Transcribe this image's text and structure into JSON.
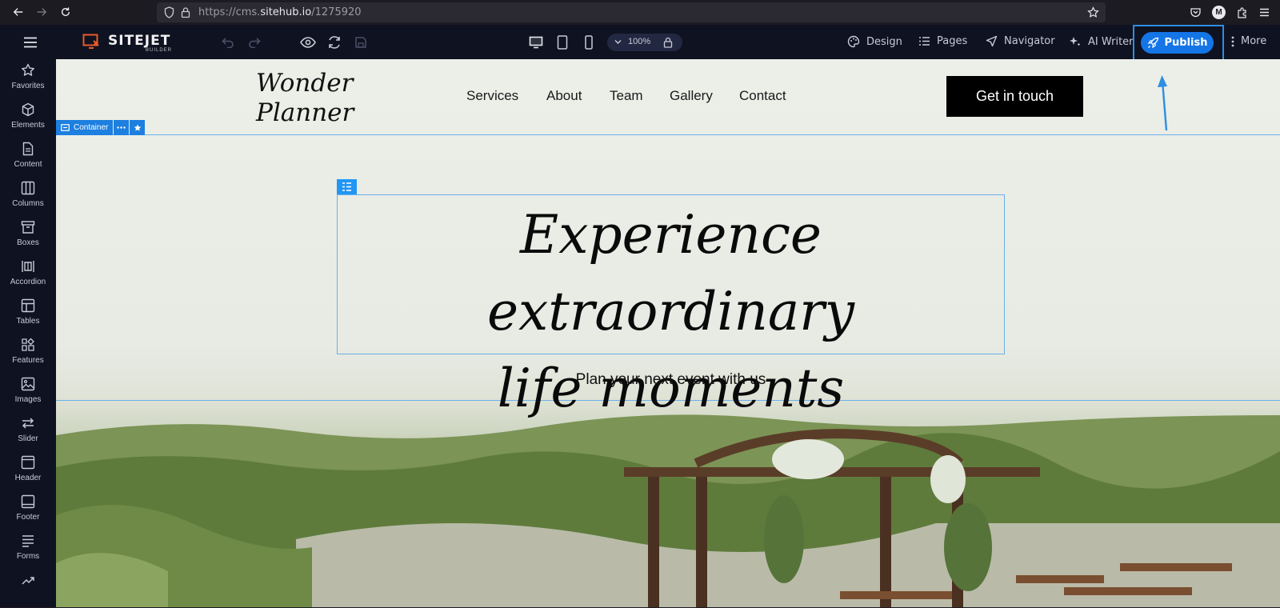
{
  "browser": {
    "url_prefix": "https://cms.",
    "url_domain": "sitehub.io",
    "url_path": "/1275920"
  },
  "toolbar": {
    "logo": "SITEJET",
    "logo_sub": "BUILDER",
    "zoom": "100%",
    "design": "Design",
    "pages": "Pages",
    "navigator": "Navigator",
    "ai_writer": "AI Writer",
    "publish": "Publish",
    "more": "More",
    "accent_color": "#1475e6"
  },
  "sidebar": {
    "items": [
      {
        "label": "Favorites",
        "icon": "star-icon"
      },
      {
        "label": "Elements",
        "icon": "cube-icon"
      },
      {
        "label": "Content",
        "icon": "document-icon"
      },
      {
        "label": "Columns",
        "icon": "columns-icon"
      },
      {
        "label": "Boxes",
        "icon": "box-icon"
      },
      {
        "label": "Accordion",
        "icon": "accordion-icon"
      },
      {
        "label": "Tables",
        "icon": "table-icon"
      },
      {
        "label": "Features",
        "icon": "features-icon"
      },
      {
        "label": "Images",
        "icon": "image-icon"
      },
      {
        "label": "Slider",
        "icon": "slider-icon"
      },
      {
        "label": "Header",
        "icon": "header-icon"
      },
      {
        "label": "Footer",
        "icon": "footer-icon"
      },
      {
        "label": "Forms",
        "icon": "form-icon"
      }
    ]
  },
  "site": {
    "logo_line1": "Wonder",
    "logo_line2": "Planner",
    "nav": [
      "Services",
      "About",
      "Team",
      "Gallery",
      "Contact"
    ],
    "cta": "Get in touch",
    "headline_line1": "Experience extraordinary",
    "headline_line2": "life moments",
    "subline": "Plan your next event with us",
    "container_tag": "Container"
  }
}
